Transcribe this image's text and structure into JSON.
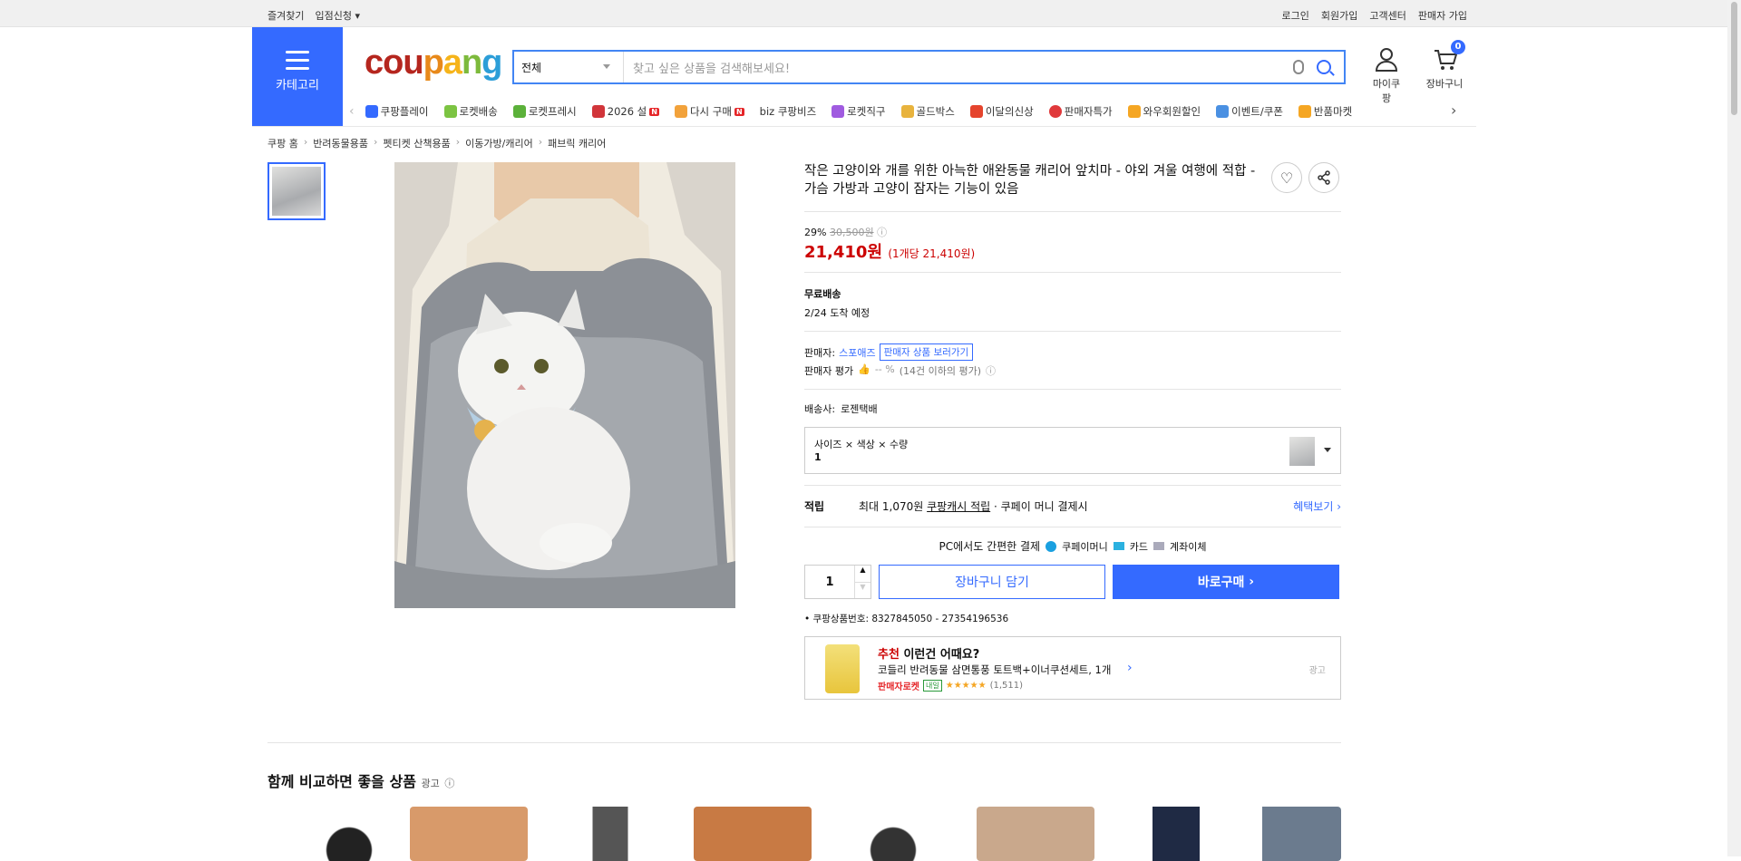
{
  "topbar": {
    "left": [
      "즐겨찾기",
      "입점신청"
    ],
    "right": [
      "로그인",
      "회원가입",
      "고객센터",
      "판매자 가입"
    ]
  },
  "header": {
    "category_label": "카테고리",
    "logo": [
      "c",
      "ou",
      "p",
      "a",
      "n",
      "g"
    ],
    "search": {
      "select_value": "전체",
      "placeholder": "찾고 싶은 상품을 검색해보세요!"
    },
    "my_label": "마이쿠팡",
    "cart_label": "장바구니",
    "cart_count": "0"
  },
  "nav": {
    "items": [
      {
        "label": "쿠팡플레이",
        "color": "#346aff"
      },
      {
        "label": "로켓배송",
        "color": "#7cc442"
      },
      {
        "label": "로켓프레시",
        "color": "#7cc442"
      },
      {
        "label": "2026 설",
        "color": "#d1353a",
        "badge": "N"
      },
      {
        "label": "다시 구매",
        "color": "#f2a23b",
        "badge": "N"
      },
      {
        "label": "biz 쿠팡비즈",
        "color": "#ffffff"
      },
      {
        "label": "로켓직구",
        "color": "#a05be0"
      },
      {
        "label": "골드박스",
        "color": "#e8b33d"
      },
      {
        "label": "이달의신상",
        "color": "#e5442d"
      },
      {
        "label": "판매자특가",
        "color": "#e0393b"
      },
      {
        "label": "와우회원할인",
        "color": "#f5a623"
      },
      {
        "label": "이벤트/쿠폰",
        "color": "#4a90e2"
      },
      {
        "label": "반품마켓",
        "color": "#f5a623"
      }
    ]
  },
  "breadcrumb": [
    "쿠팡 홈",
    "반려동물용품",
    "펫티켓 산책용품",
    "이동가방/캐리어",
    "패브릭 캐리어"
  ],
  "product": {
    "title": "작은 고양이와 개를 위한 아늑한 애완동물 캐리어 앞치마 - 야외 겨울 여행에 적합 - 가슴 가방과 고양이 잠자는 기능이 있음",
    "discount": "29%",
    "original_price": "30,500원",
    "price": "21,410원",
    "unit_price": "(1개당 21,410원)",
    "shipping_title": "무료배송",
    "shipping_date": "2/24 도착 예정",
    "seller_label": "판매자:",
    "seller_name": "스포애즈",
    "seller_button": "판매자 상품 보러가기",
    "seller_rating_label": "판매자 평가",
    "seller_rating_value": "-- %",
    "seller_rating_note": "(14건 이하의 평가)",
    "courier_label": "배송사:",
    "courier_name": "로젠택배",
    "option_label": "사이즈 × 색상 × 수량",
    "option_value": "1",
    "reward_label": "적립",
    "reward_prefix": "최대 1,070원",
    "reward_link": "쿠팡캐시 적립",
    "reward_suffix": "· 쿠페이 머니 결제시",
    "reward_more": "혜택보기",
    "pay_title": "PC에서도 간편한 결제",
    "pay_methods": [
      "쿠페이머니",
      "카드",
      "계좌이체"
    ],
    "quantity": "1",
    "cart_button": "장바구니 담기",
    "buy_button": "바로구매",
    "product_no": "쿠팡상품번호: 8327845050 - 27354196536"
  },
  "recommend": {
    "tag": "추천",
    "title": "이런건 어때요?",
    "name": "코들리 반려동물 삼면통풍 토트백+이너쿠션세트, 1개",
    "seller_rocket": "판매자로켓",
    "badge": "내일",
    "reviews": "(1,511)",
    "ad": "광고"
  },
  "compare": {
    "title": "함께 비교하면 좋을 상품",
    "ad": "광고"
  },
  "colors": {
    "accent": "#346aff",
    "price": "#c00000"
  }
}
